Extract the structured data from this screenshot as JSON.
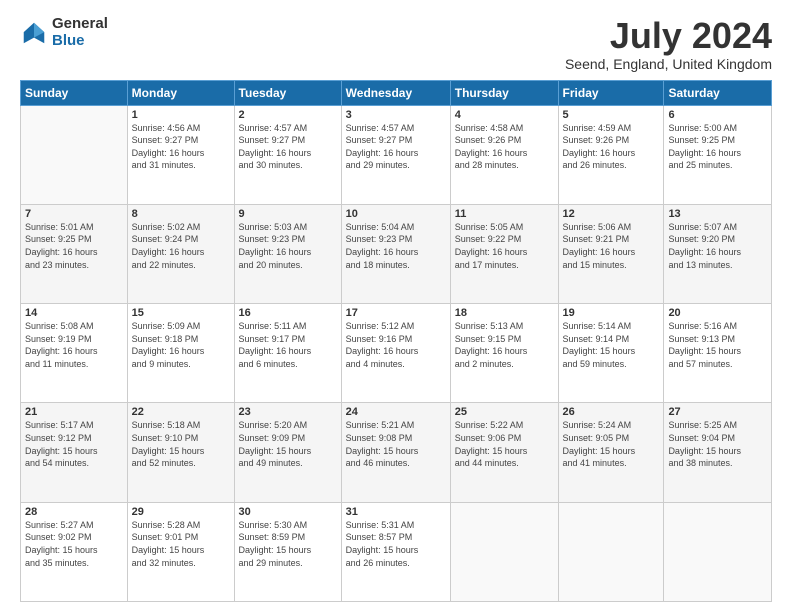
{
  "header": {
    "logo_general": "General",
    "logo_blue": "Blue",
    "month_title": "July 2024",
    "location": "Seend, England, United Kingdom"
  },
  "days_of_week": [
    "Sunday",
    "Monday",
    "Tuesday",
    "Wednesday",
    "Thursday",
    "Friday",
    "Saturday"
  ],
  "weeks": [
    {
      "shade": "white",
      "days": [
        {
          "num": "",
          "info": ""
        },
        {
          "num": "1",
          "info": "Sunrise: 4:56 AM\nSunset: 9:27 PM\nDaylight: 16 hours\nand 31 minutes."
        },
        {
          "num": "2",
          "info": "Sunrise: 4:57 AM\nSunset: 9:27 PM\nDaylight: 16 hours\nand 30 minutes."
        },
        {
          "num": "3",
          "info": "Sunrise: 4:57 AM\nSunset: 9:27 PM\nDaylight: 16 hours\nand 29 minutes."
        },
        {
          "num": "4",
          "info": "Sunrise: 4:58 AM\nSunset: 9:26 PM\nDaylight: 16 hours\nand 28 minutes."
        },
        {
          "num": "5",
          "info": "Sunrise: 4:59 AM\nSunset: 9:26 PM\nDaylight: 16 hours\nand 26 minutes."
        },
        {
          "num": "6",
          "info": "Sunrise: 5:00 AM\nSunset: 9:25 PM\nDaylight: 16 hours\nand 25 minutes."
        }
      ]
    },
    {
      "shade": "shade",
      "days": [
        {
          "num": "7",
          "info": "Sunrise: 5:01 AM\nSunset: 9:25 PM\nDaylight: 16 hours\nand 23 minutes."
        },
        {
          "num": "8",
          "info": "Sunrise: 5:02 AM\nSunset: 9:24 PM\nDaylight: 16 hours\nand 22 minutes."
        },
        {
          "num": "9",
          "info": "Sunrise: 5:03 AM\nSunset: 9:23 PM\nDaylight: 16 hours\nand 20 minutes."
        },
        {
          "num": "10",
          "info": "Sunrise: 5:04 AM\nSunset: 9:23 PM\nDaylight: 16 hours\nand 18 minutes."
        },
        {
          "num": "11",
          "info": "Sunrise: 5:05 AM\nSunset: 9:22 PM\nDaylight: 16 hours\nand 17 minutes."
        },
        {
          "num": "12",
          "info": "Sunrise: 5:06 AM\nSunset: 9:21 PM\nDaylight: 16 hours\nand 15 minutes."
        },
        {
          "num": "13",
          "info": "Sunrise: 5:07 AM\nSunset: 9:20 PM\nDaylight: 16 hours\nand 13 minutes."
        }
      ]
    },
    {
      "shade": "white",
      "days": [
        {
          "num": "14",
          "info": "Sunrise: 5:08 AM\nSunset: 9:19 PM\nDaylight: 16 hours\nand 11 minutes."
        },
        {
          "num": "15",
          "info": "Sunrise: 5:09 AM\nSunset: 9:18 PM\nDaylight: 16 hours\nand 9 minutes."
        },
        {
          "num": "16",
          "info": "Sunrise: 5:11 AM\nSunset: 9:17 PM\nDaylight: 16 hours\nand 6 minutes."
        },
        {
          "num": "17",
          "info": "Sunrise: 5:12 AM\nSunset: 9:16 PM\nDaylight: 16 hours\nand 4 minutes."
        },
        {
          "num": "18",
          "info": "Sunrise: 5:13 AM\nSunset: 9:15 PM\nDaylight: 16 hours\nand 2 minutes."
        },
        {
          "num": "19",
          "info": "Sunrise: 5:14 AM\nSunset: 9:14 PM\nDaylight: 15 hours\nand 59 minutes."
        },
        {
          "num": "20",
          "info": "Sunrise: 5:16 AM\nSunset: 9:13 PM\nDaylight: 15 hours\nand 57 minutes."
        }
      ]
    },
    {
      "shade": "shade",
      "days": [
        {
          "num": "21",
          "info": "Sunrise: 5:17 AM\nSunset: 9:12 PM\nDaylight: 15 hours\nand 54 minutes."
        },
        {
          "num": "22",
          "info": "Sunrise: 5:18 AM\nSunset: 9:10 PM\nDaylight: 15 hours\nand 52 minutes."
        },
        {
          "num": "23",
          "info": "Sunrise: 5:20 AM\nSunset: 9:09 PM\nDaylight: 15 hours\nand 49 minutes."
        },
        {
          "num": "24",
          "info": "Sunrise: 5:21 AM\nSunset: 9:08 PM\nDaylight: 15 hours\nand 46 minutes."
        },
        {
          "num": "25",
          "info": "Sunrise: 5:22 AM\nSunset: 9:06 PM\nDaylight: 15 hours\nand 44 minutes."
        },
        {
          "num": "26",
          "info": "Sunrise: 5:24 AM\nSunset: 9:05 PM\nDaylight: 15 hours\nand 41 minutes."
        },
        {
          "num": "27",
          "info": "Sunrise: 5:25 AM\nSunset: 9:04 PM\nDaylight: 15 hours\nand 38 minutes."
        }
      ]
    },
    {
      "shade": "white",
      "days": [
        {
          "num": "28",
          "info": "Sunrise: 5:27 AM\nSunset: 9:02 PM\nDaylight: 15 hours\nand 35 minutes."
        },
        {
          "num": "29",
          "info": "Sunrise: 5:28 AM\nSunset: 9:01 PM\nDaylight: 15 hours\nand 32 minutes."
        },
        {
          "num": "30",
          "info": "Sunrise: 5:30 AM\nSunset: 8:59 PM\nDaylight: 15 hours\nand 29 minutes."
        },
        {
          "num": "31",
          "info": "Sunrise: 5:31 AM\nSunset: 8:57 PM\nDaylight: 15 hours\nand 26 minutes."
        },
        {
          "num": "",
          "info": ""
        },
        {
          "num": "",
          "info": ""
        },
        {
          "num": "",
          "info": ""
        }
      ]
    }
  ]
}
